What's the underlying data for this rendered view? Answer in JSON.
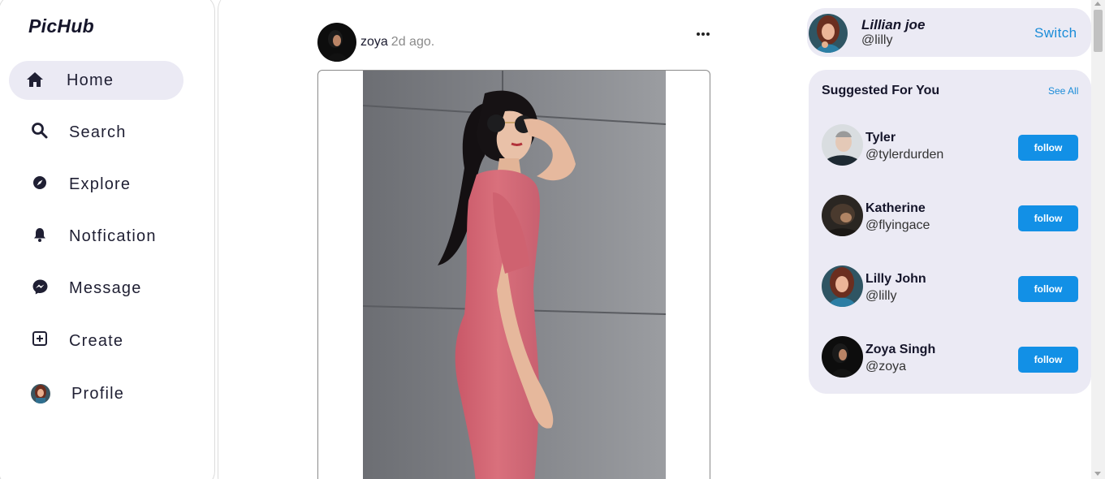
{
  "app": {
    "logo": "PicHub"
  },
  "sidebar": {
    "items": [
      {
        "label": "Home",
        "icon": "home-icon",
        "active": true
      },
      {
        "label": "Search",
        "icon": "search-icon"
      },
      {
        "label": "Explore",
        "icon": "compass-icon"
      },
      {
        "label": "Notfication",
        "icon": "bell-icon"
      },
      {
        "label": "Message",
        "icon": "messenger-icon"
      },
      {
        "label": "Create",
        "icon": "plus-square-icon"
      },
      {
        "label": "Profile",
        "icon": "profile-avatar"
      }
    ]
  },
  "post": {
    "username": "zoya",
    "time": "2d ago.",
    "more_icon": "more-horizontal-icon"
  },
  "account": {
    "name": "Lillian joe",
    "handle": "@lilly",
    "switch_label": "Switch"
  },
  "suggestions": {
    "title": "Suggested For You",
    "see_all": "See All",
    "follow_label": "follow",
    "users": [
      {
        "name": "Tyler",
        "handle": "@tylerdurden"
      },
      {
        "name": "Katherine",
        "handle": "@flyingace"
      },
      {
        "name": "Lilly John",
        "handle": "@lilly"
      },
      {
        "name": "Zoya Singh",
        "handle": "@zoya"
      }
    ]
  },
  "colors": {
    "accent": "#1290e6",
    "link": "#1a8cd8",
    "card_bg": "#ebeaf4",
    "text_dark": "#15152a"
  }
}
